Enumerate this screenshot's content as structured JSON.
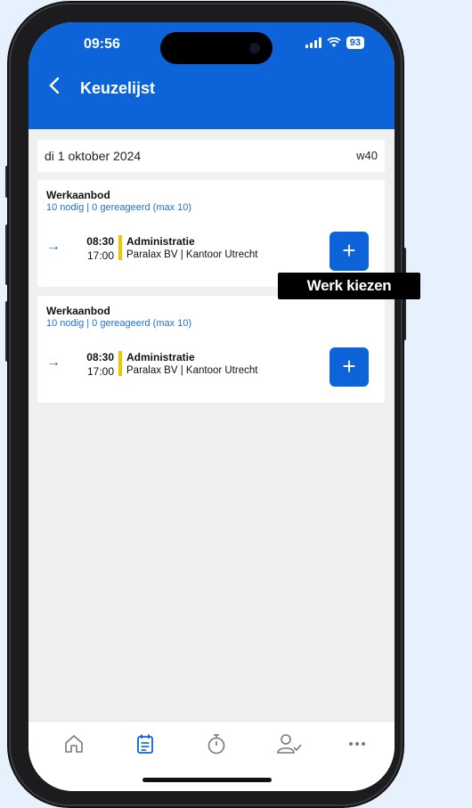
{
  "status_bar": {
    "time": "09:56",
    "battery": "93"
  },
  "header": {
    "title": "Keuzelijst"
  },
  "date_bar": {
    "date": "di 1 oktober 2024",
    "week": "w40"
  },
  "cards": [
    {
      "title": "Werkaanbod",
      "subtitle": "10 nodig | 0 gereageerd (max 10)",
      "start": "08:30",
      "end": "17:00",
      "role": "Administratie",
      "location": "Paralax BV | Kantoor Utrecht",
      "add_label": "+"
    },
    {
      "title": "Werkaanbod",
      "subtitle": "10 nodig | 0 gereageerd (max 10)",
      "start": "08:30",
      "end": "17:00",
      "role": "Administratie",
      "location": "Paralax BV | Kantoor Utrecht",
      "add_label": "+"
    }
  ],
  "tooltip": {
    "text": "Werk kiezen"
  },
  "tabs": [
    {
      "icon": "home-icon",
      "active": false
    },
    {
      "icon": "calendar-list-icon",
      "active": true
    },
    {
      "icon": "stopwatch-icon",
      "active": false
    },
    {
      "icon": "user-check-icon",
      "active": false
    },
    {
      "icon": "more-icon",
      "active": false
    }
  ],
  "colors": {
    "brand": "#0d64d8",
    "accent_bar": "#f5c400",
    "background": "#e6f1fd"
  }
}
